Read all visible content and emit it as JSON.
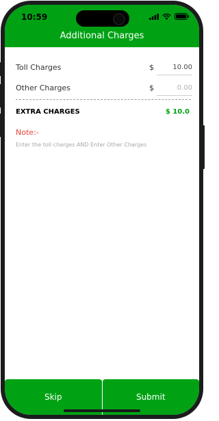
{
  "status_bar": {
    "time": "10:59",
    "icons": [
      "signal-icon",
      "wifi-icon",
      "battery-icon"
    ]
  },
  "header": {
    "title": "Additional Charges"
  },
  "charges": [
    {
      "label": "Toll Charges",
      "currency": "$",
      "value": "10.00",
      "placeholder": ""
    },
    {
      "label": "Other Charges",
      "currency": "$",
      "value": "",
      "placeholder": "0.00"
    }
  ],
  "summary": {
    "label": "EXTRA CHARGES",
    "value": "$ 10.0"
  },
  "note": {
    "title": "Note:-",
    "text": "Enter the toll charges AND Enter Other Charges"
  },
  "footer": {
    "skip_label": "Skip",
    "submit_label": "Submit"
  },
  "colors": {
    "brand_green": "#00a214",
    "note_red": "#e8473b",
    "text_dark": "#000000",
    "text_muted": "#a8a8a8"
  }
}
